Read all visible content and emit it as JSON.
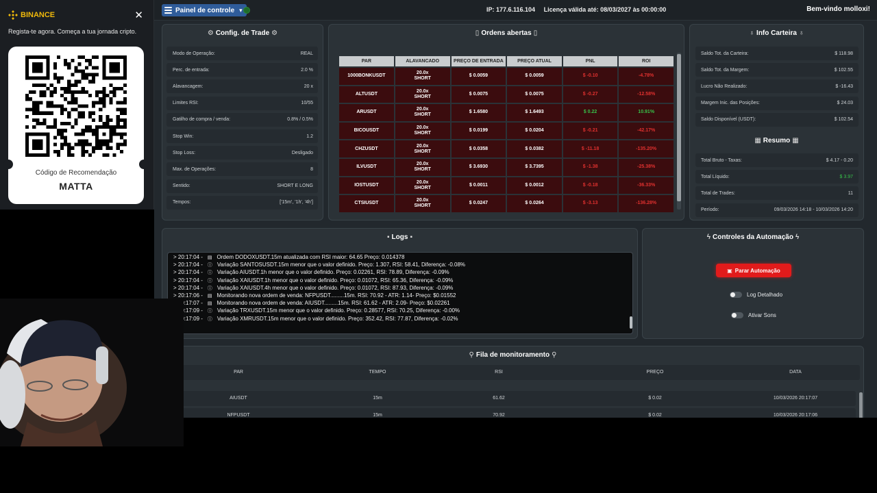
{
  "topbar": {
    "menu_label": "Painel de controle",
    "ip": "IP: 177.6.116.104",
    "license": "Licença válida até: 08/03/2027 às 00:00:00",
    "welcome": "Bem-vindo molloxi!"
  },
  "config": {
    "title": "Config. de Trade",
    "rows": [
      {
        "label": "Modo de Operação:",
        "value": "REAL"
      },
      {
        "label": "Perc. de entrada:",
        "value": "2.0 %"
      },
      {
        "label": "Alavancagem:",
        "value": "20 x"
      },
      {
        "label": "Limites RSI:",
        "value": "10/55"
      },
      {
        "label": "Gatilho de compra / venda:",
        "value": "0.8% / 0.5%"
      },
      {
        "label": "Stop Win:",
        "value": "1.2"
      },
      {
        "label": "Stop Loss:",
        "value": "Desligado"
      },
      {
        "label": "Max. de Operações:",
        "value": "8"
      },
      {
        "label": "Sentido:",
        "value": "SHORT E LONG"
      },
      {
        "label": "Tempos:",
        "value": "['15m', '1h', '4h']"
      }
    ]
  },
  "orders": {
    "title": "Ordens abertas",
    "columns": [
      "PAR",
      "ALAVANCADO",
      "PREÇO DE ENTRADA",
      "PREÇO ATUAL",
      "PNL",
      "ROI"
    ],
    "rows": [
      {
        "pair": "1000BONKUSDT",
        "lev": "20.0x",
        "side": "SHORT",
        "entry": "$ 0.0059",
        "current": "$ 0.0059",
        "pnl": "$ -0.10",
        "roi": "-4.78%",
        "sign": "neg"
      },
      {
        "pair": "ALTUSDT",
        "lev": "20.0x",
        "side": "SHORT",
        "entry": "$ 0.0075",
        "current": "$ 0.0075",
        "pnl": "$ -0.27",
        "roi": "-12.58%",
        "sign": "neg"
      },
      {
        "pair": "ARUSDT",
        "lev": "20.0x",
        "side": "SHORT",
        "entry": "$ 1.6580",
        "current": "$ 1.6493",
        "pnl": "$ 0.22",
        "roi": "10.91%",
        "sign": "pos"
      },
      {
        "pair": "BICOUSDT",
        "lev": "20.0x",
        "side": "SHORT",
        "entry": "$ 0.0199",
        "current": "$ 0.0204",
        "pnl": "$ -0.21",
        "roi": "-42.17%",
        "sign": "neg"
      },
      {
        "pair": "CHZUSDT",
        "lev": "20.0x",
        "side": "SHORT",
        "entry": "$ 0.0358",
        "current": "$ 0.0382",
        "pnl": "$ -11.18",
        "roi": "-135.20%",
        "sign": "neg"
      },
      {
        "pair": "ILVUSDT",
        "lev": "20.0x",
        "side": "SHORT",
        "entry": "$ 3.6930",
        "current": "$ 3.7395",
        "pnl": "$ -1.38",
        "roi": "-25.38%",
        "sign": "neg"
      },
      {
        "pair": "IOSTUSDT",
        "lev": "20.0x",
        "side": "SHORT",
        "entry": "$ 0.0011",
        "current": "$ 0.0012",
        "pnl": "$ -0.18",
        "roi": "-36.33%",
        "sign": "neg"
      },
      {
        "pair": "CTSIUSDT",
        "lev": "20.0x",
        "side": "SHORT",
        "entry": "$ 0.0247",
        "current": "$ 0.0264",
        "pnl": "$ -3.13",
        "roi": "-136.28%",
        "sign": "neg"
      }
    ]
  },
  "wallet": {
    "title": "Info Carteira",
    "rows": [
      {
        "label": "Saldo Tot. da Carteira:",
        "value": "$ 118.98"
      },
      {
        "label": "Saldo Tot. da Margem:",
        "value": "$ 102.55"
      },
      {
        "label": "Lucro Não Realizado:",
        "value": "$ -16.43"
      },
      {
        "label": "Margem Inic. das Posições:",
        "value": "$ 24.03"
      },
      {
        "label": "Saldo Disponível (USDT):",
        "value": "$ 102.54"
      }
    ],
    "summary_title": "Resumo",
    "summary": [
      {
        "label": "Total Bruto - Taxas:",
        "value": "$ 4.17 - 0.20"
      },
      {
        "label": "Total Líquido:",
        "value": "$ 3.97"
      },
      {
        "label": "Total de Trades:",
        "value": "11"
      },
      {
        "label": "Período:",
        "value": "09/03/2026 14:18 - 10/03/2026 14:20"
      }
    ]
  },
  "logs": {
    "title": "Logs",
    "lines": [
      {
        "time": "> 20:17:04 -",
        "icon": "list",
        "text": "Ordem DODOXUSDT.15m atualizada com RSI maior: 64.65 Preço: 0.014378"
      },
      {
        "time": "> 20:17:04 -",
        "icon": "info",
        "text": "Variação SANTOSUSDT.15m menor que o valor definido. Preço: 1.307, RSI: 58.41, Diferença: -0.08%"
      },
      {
        "time": "> 20:17:04 -",
        "icon": "info",
        "text": "Variação AIUSDT.1h menor que o valor definido. Preço: 0.02261, RSI: 78.89, Diferença: -0.09%"
      },
      {
        "time": "> 20:17:04 -",
        "icon": "info",
        "text": "Variação XAIUSDT.1h menor que o valor definido. Preço: 0.01072, RSI: 65.36, Diferença: -0.09%"
      },
      {
        "time": "> 20:17:04 -",
        "icon": "info",
        "text": "Variação XAIUSDT.4h menor que o valor definido. Preço: 0.01072, RSI: 87.93, Diferença: -0.09%"
      },
      {
        "time": "> 20:17:06 -",
        "icon": "list",
        "text": "Monitorando nova ordem de venda: NFPUSDT.........15m. RSI: 70.92 - ATR: 1.14- Preço: $0.01552"
      },
      {
        "time": "> 20:17:07 -",
        "icon": "list",
        "text": "Monitorando nova ordem de venda: AIUSDT.........15m. RSI: 61.62 - ATR: 2.09- Preço: $0.02261"
      },
      {
        "time": "> 20:17:09 -",
        "icon": "info",
        "text": "Variação TRXUSDT.15m menor que o valor definido. Preço: 0.28577, RSI: 70.25, Diferença: -0.00%"
      },
      {
        "time": "> 20:17:09 -",
        "icon": "info",
        "text": "Variação XMRUSDT.15m menor que o valor definido. Preço: 352.42, RSI: 77.87, Diferença: -0.02%"
      }
    ]
  },
  "automation": {
    "title": "Controles da Automação",
    "stop_label": "Parar Automação",
    "toggle_log": "Log Detalhado",
    "toggle_sound": "Ativar Sons"
  },
  "queue": {
    "title": "Fila de monitoramento",
    "columns": [
      "PAR",
      "TEMPO",
      "RSI",
      "PREÇO",
      "DATA"
    ],
    "rows": [
      {
        "pair": "AIUSDT",
        "time": "15m",
        "rsi": "61.62",
        "price": "$ 0.02",
        "date": "10/03/2026 20:17:07"
      },
      {
        "pair": "NFPUSDT",
        "time": "15m",
        "rsi": "70.92",
        "price": "$ 0.02",
        "date": "10/03/2026 20:17:06"
      }
    ]
  },
  "binance": {
    "brand": "BINANCE",
    "subtitle": "Regista-te agora. Começa a tua jornada cripto.",
    "code_label": "Código de Recomendação",
    "code": "MATTA"
  },
  "colors": {
    "accent": "#2f5c9a",
    "stop": "#e21b1b",
    "negative": "#e0312f",
    "positive": "#37c24a",
    "binance_yellow": "#f0b90b"
  }
}
